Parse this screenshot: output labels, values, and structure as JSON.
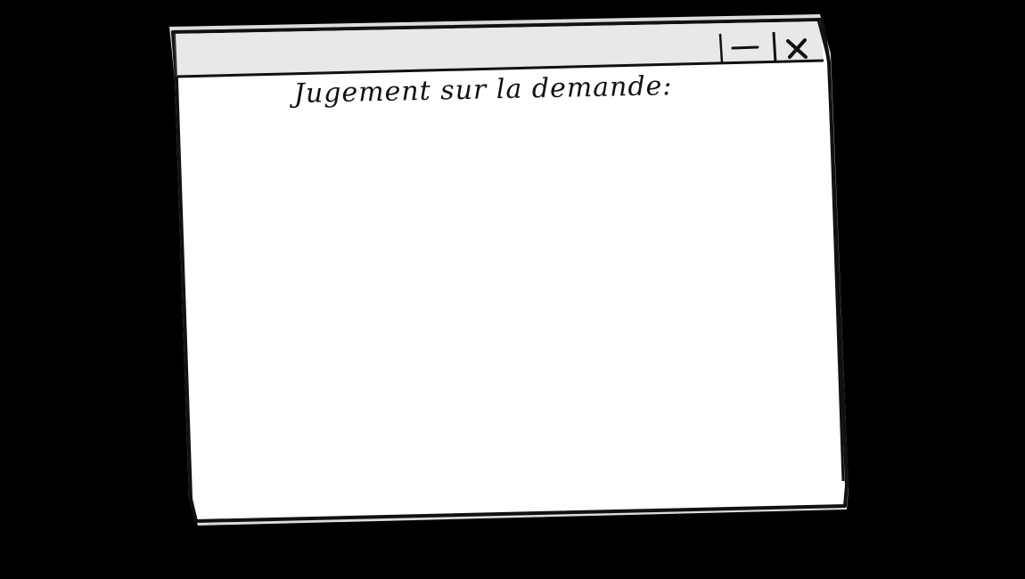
{
  "window": {
    "content_label": "Jugement sur la demande:"
  },
  "titlebar": {
    "minimize_icon": "minimize-icon",
    "close_icon": "close-icon"
  },
  "colors": {
    "background": "#000000",
    "window_body": "#ffffff",
    "titlebar": "#e6e6e6",
    "outline": "#111111"
  }
}
